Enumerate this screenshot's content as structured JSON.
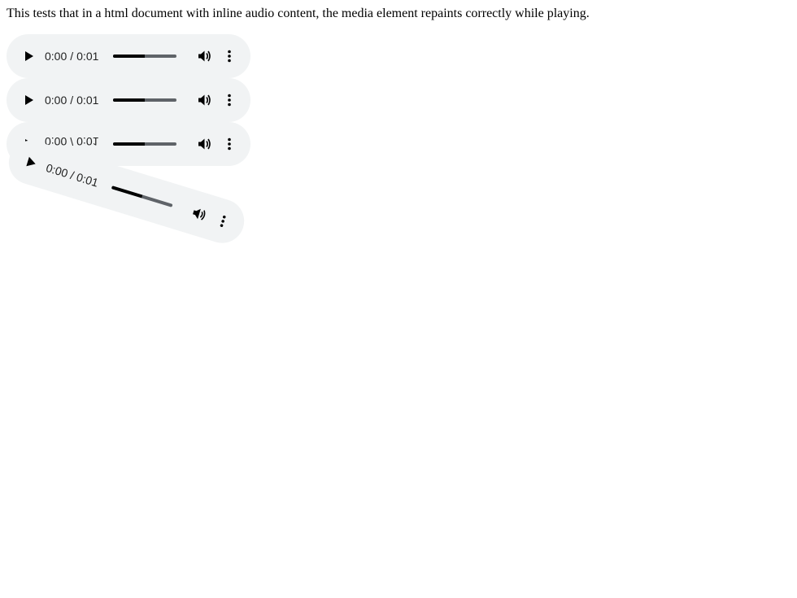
{
  "description": "This tests that in a html document with inline audio content, the media element repaints correctly while playing.",
  "players": [
    {
      "current_time": "0:00",
      "separator": "/",
      "duration": "0:01",
      "progress": 0.5,
      "play_icon": "play-icon",
      "volume_icon": "volume-icon",
      "menu_icon": "more-vert-icon"
    },
    {
      "current_time": "0:00",
      "separator": "/",
      "duration": "0:01",
      "progress": 0.5,
      "play_icon": "play-icon",
      "volume_icon": "volume-icon",
      "menu_icon": "more-vert-icon"
    },
    {
      "current_time": "0:00",
      "separator": "/",
      "duration": "0:01",
      "progress": 0.5,
      "play_icon": "play-icon",
      "volume_icon": "volume-icon",
      "menu_icon": "more-vert-icon"
    },
    {
      "current_time": "0:00",
      "separator": "/",
      "duration": "0:01",
      "progress": 0.5,
      "play_icon": "play-icon",
      "volume_icon": "volume-icon",
      "menu_icon": "more-vert-icon"
    }
  ],
  "colors": {
    "player_background": "#f1f3f4",
    "progress_played": "#000000",
    "progress_remaining": "#5f6368"
  }
}
